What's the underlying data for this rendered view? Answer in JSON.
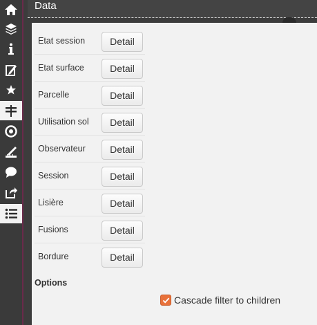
{
  "header": {
    "title": "Data"
  },
  "sidebar": {
    "items": [
      {
        "icon": "home-icon",
        "active": false
      },
      {
        "icon": "layers-icon",
        "active": false
      },
      {
        "icon": "info-icon",
        "active": false
      },
      {
        "icon": "clipboard-pen-icon",
        "active": false
      },
      {
        "icon": "star-icon",
        "active": false
      },
      {
        "icon": "signpost-icon",
        "active": true
      },
      {
        "icon": "target-icon",
        "active": false
      },
      {
        "icon": "measure-icon",
        "active": false
      },
      {
        "icon": "comment-icon",
        "active": false
      },
      {
        "icon": "share-icon",
        "active": false
      },
      {
        "icon": "list-icon",
        "active": true
      }
    ]
  },
  "data_list": {
    "button_label": "Detail",
    "rows": [
      {
        "label": "Etat session"
      },
      {
        "label": "Etat surface"
      },
      {
        "label": "Parcelle"
      },
      {
        "label": "Utilisation sol"
      },
      {
        "label": "Observateur"
      },
      {
        "label": "Session"
      },
      {
        "label": "Lisière"
      },
      {
        "label": "Fusions"
      },
      {
        "label": "Bordure"
      }
    ]
  },
  "options": {
    "title": "Options",
    "cascade_label": "Cascade filter to children",
    "cascade_checked": true
  },
  "colors": {
    "accent": "#e8713a",
    "sidebar": "#3a3a3a",
    "panel": "#f2f2f2"
  }
}
